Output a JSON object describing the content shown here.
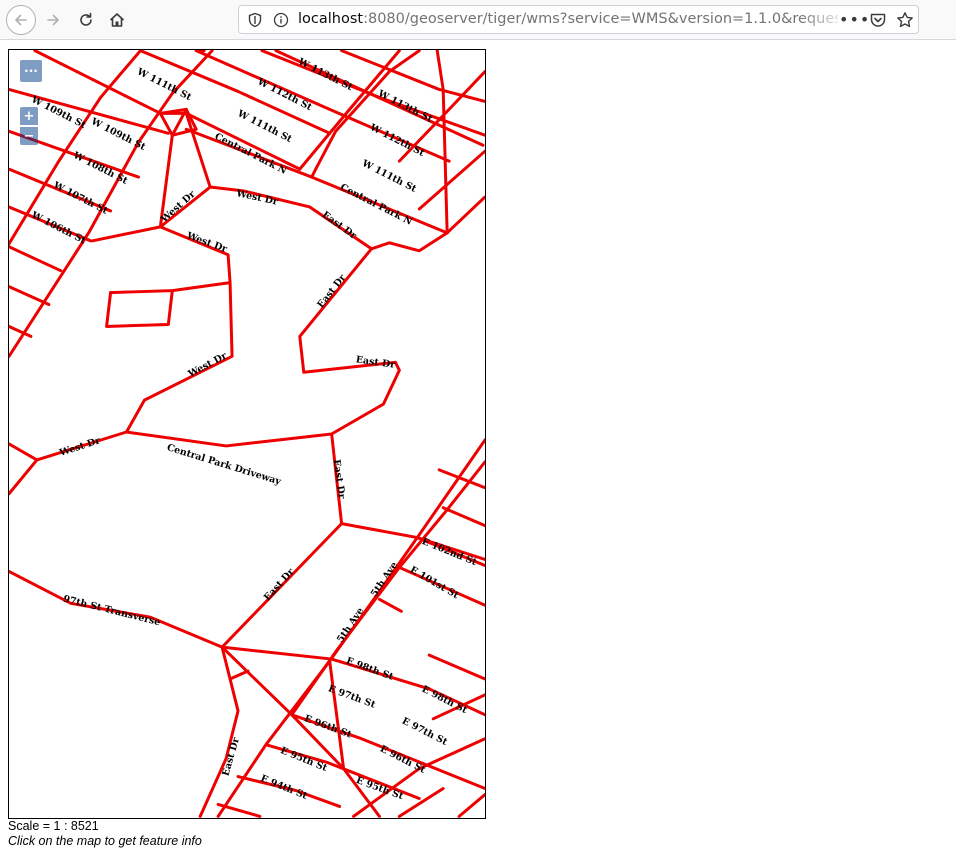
{
  "browser": {
    "url_host": "localhost",
    "url_rest": ":8080/geoserver/tiger/wms?service=WMS&version=1.1.0&request"
  },
  "map": {
    "road_color": "#ee0000",
    "controls": {
      "menu": "···",
      "zoom_in": "+",
      "zoom_out": "−"
    },
    "labels": [
      "W 113th St",
      "W 113th St",
      "W 111th St",
      "W 112th St",
      "W 112th St",
      "W 109th St",
      "W 109th St",
      "W 111th St",
      "W 111th St",
      "Central Park N",
      "Central Park N",
      "W 108th St",
      "W 107th St",
      "W 106th St",
      "West Dr",
      "West Dr",
      "West Dr",
      "West Dr",
      "West Dr",
      "East Dr",
      "East Dr",
      "East Dr",
      "East Dr",
      "East Dr",
      "East Dr",
      "Central Park Driveway",
      "E 102nd St",
      "E 101st St",
      "97th St Transverse",
      "5th Ave",
      "5th Ave",
      "E 98th St",
      "E 98th St",
      "E 97th St",
      "E 97th St",
      "E 96th St",
      "E 96th St",
      "E 95th St",
      "E 95th St",
      "E 94th St"
    ]
  },
  "footer": {
    "scale": "Scale = 1 : 8521",
    "hint": "Click on the map to get feature info"
  }
}
